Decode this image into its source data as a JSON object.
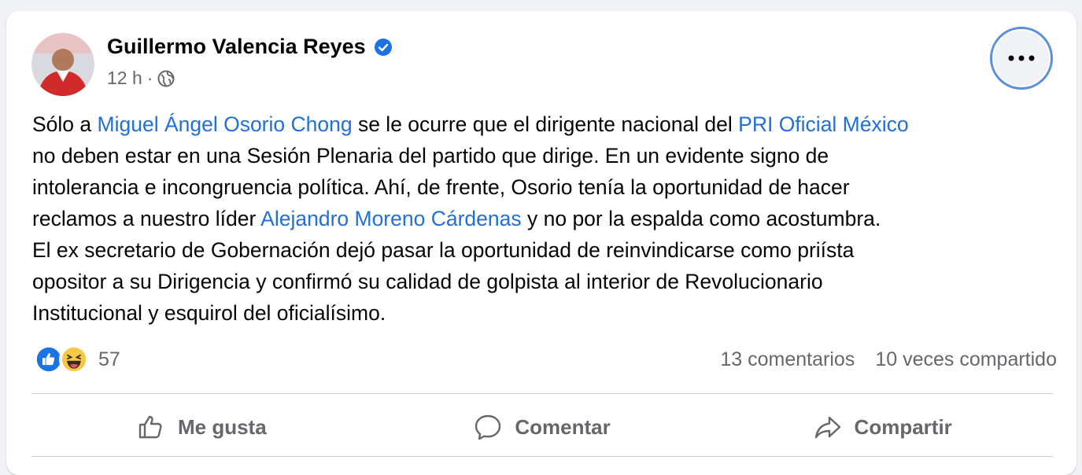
{
  "post": {
    "author": "Guillermo Valencia Reyes",
    "time": "12 h",
    "dot": "·",
    "lines": [
      {
        "parts": [
          {
            "t": "Sólo a ",
            "m": false
          },
          {
            "t": "Miguel Ángel Osorio Chong",
            "m": true
          },
          {
            "t": " se le ocurre que el dirigente nacional del ",
            "m": false
          },
          {
            "t": "PRI Oficial México",
            "m": true
          }
        ]
      },
      {
        "parts": [
          {
            "t": "no deben estar en una Sesión Plenaria del partido que dirige. En un evidente signo de",
            "m": false
          }
        ]
      },
      {
        "parts": [
          {
            "t": "intolerancia e incongruencia política. Ahí, de frente, Osorio tenía la oportunidad de hacer",
            "m": false
          }
        ]
      },
      {
        "parts": [
          {
            "t": "reclamos a nuestro líder ",
            "m": false
          },
          {
            "t": "Alejandro Moreno Cárdenas",
            "m": true
          },
          {
            "t": " y no por la espalda como acostumbra.",
            "m": false
          }
        ]
      },
      {
        "parts": [
          {
            "t": "El ex secretario de Gobernación dejó pasar la oportunidad de reinvindicarse como priísta",
            "m": false
          }
        ]
      },
      {
        "parts": [
          {
            "t": "opositor a su Dirigencia y confirmó su calidad de golpista al interior de Revolucionario",
            "m": false
          }
        ]
      },
      {
        "parts": [
          {
            "t": "Institucional y esquirol del oficialísimo.",
            "m": false
          }
        ]
      }
    ],
    "reaction_icons": [
      "like-icon",
      "haha-icon"
    ],
    "reaction_count": "57",
    "comments": "13 comentarios",
    "shares": "10 veces compartido"
  },
  "actions": {
    "like": "Me gusta",
    "comment": "Comentar",
    "share": "Compartir"
  },
  "colors": {
    "mention": "#216fdb",
    "secondary_text": "#65676b",
    "verified": "#1b74e4",
    "focus_ring": "#5b8fdc"
  }
}
